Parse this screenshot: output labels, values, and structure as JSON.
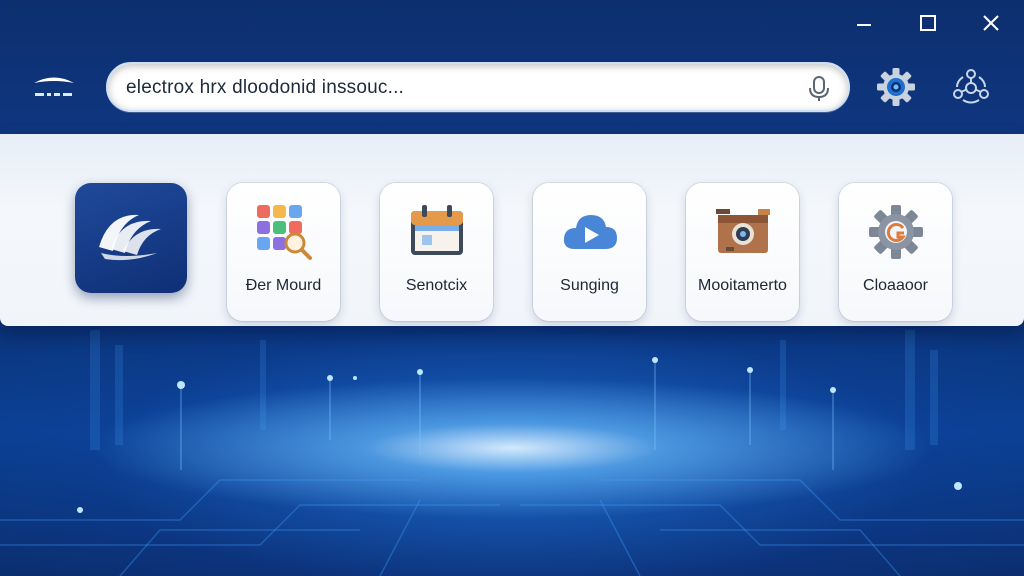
{
  "window": {
    "controls": [
      "minimize",
      "maximize",
      "close"
    ]
  },
  "header": {
    "logo_icon": "wing-logo-icon",
    "search": {
      "value": "electrox hrx dloodonid inssouc...",
      "mic_icon": "microphone-icon"
    },
    "settings_icon": "gear-icon",
    "network_icon": "network-nodes-icon"
  },
  "apps": {
    "featured": {
      "icon": "feather-wing-icon"
    },
    "items": [
      {
        "label": "Ðer Mourd",
        "icon": "grid-search-icon"
      },
      {
        "label": "Senotcix",
        "icon": "calendar-icon"
      },
      {
        "label": "Sunging",
        "icon": "cloud-play-icon"
      },
      {
        "label": "Mooitamerto",
        "icon": "camera-box-icon"
      },
      {
        "label": "Cloaaoor",
        "icon": "settings-gear-icon"
      }
    ]
  },
  "colors": {
    "header_bg": "#0f3680",
    "panel_bg": "#f1f5fa",
    "accent": "#1f4a9a"
  }
}
